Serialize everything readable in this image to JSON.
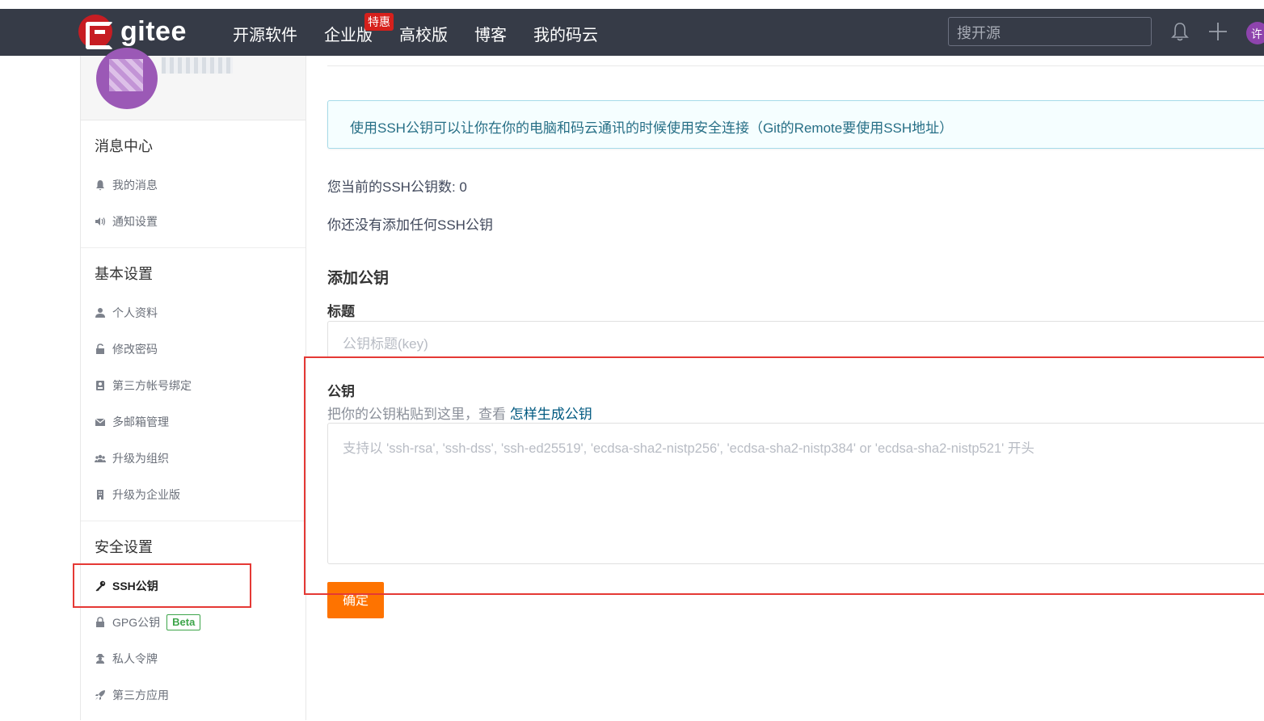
{
  "header": {
    "logo_text": "gitee",
    "nav": [
      {
        "label": "开源软件"
      },
      {
        "label": "企业版",
        "badge": "特惠"
      },
      {
        "label": "高校版"
      },
      {
        "label": "博客"
      },
      {
        "label": "我的码云"
      }
    ],
    "search_placeholder": "搜开源",
    "avatar_initial": "许",
    "icons": [
      "bell-icon",
      "plus-icon"
    ]
  },
  "sidebar": {
    "groups": [
      {
        "title": "消息中心",
        "items": [
          {
            "label": "我的消息",
            "icon": "bell-icon"
          },
          {
            "label": "通知设置",
            "icon": "volume-icon"
          }
        ]
      },
      {
        "title": "基本设置",
        "items": [
          {
            "label": "个人资料",
            "icon": "user-icon"
          },
          {
            "label": "修改密码",
            "icon": "unlock-icon"
          },
          {
            "label": "第三方帐号绑定",
            "icon": "id-card-icon"
          },
          {
            "label": "多邮箱管理",
            "icon": "mail-icon"
          },
          {
            "label": "升级为组织",
            "icon": "users-icon"
          },
          {
            "label": "升级为企业版",
            "icon": "building-icon"
          }
        ]
      },
      {
        "title": "安全设置",
        "items": [
          {
            "label": "SSH公钥",
            "icon": "key-icon",
            "active": true
          },
          {
            "label": "GPG公钥",
            "icon": "lock-icon",
            "badge": "Beta"
          },
          {
            "label": "私人令牌",
            "icon": "user-secret-icon"
          },
          {
            "label": "第三方应用",
            "icon": "rocket-icon"
          }
        ]
      }
    ]
  },
  "main": {
    "info": "使用SSH公钥可以让你在你的电脑和码云通讯的时候使用安全连接（Git的Remote要使用SSH地址）",
    "count_text": "您当前的SSH公钥数: 0",
    "empty_text": "你还没有添加任何SSH公钥",
    "add_heading": "添加公钥",
    "title_label": "标题",
    "title_placeholder": "公钥标题(key)",
    "key_label": "公钥",
    "key_hint": "把你的公钥粘贴到这里，查看 ",
    "key_hint_link": "怎样生成公钥",
    "key_placeholder": "支持以 'ssh-rsa', 'ssh-dss', 'ssh-ed25519', 'ecdsa-sha2-nistp256', 'ecdsa-sha2-nistp384' or 'ecdsa-sha2-nistp521' 开头",
    "submit_label": "确定"
  },
  "colors": {
    "topbar": "#363b47",
    "brand_red": "#c71d23",
    "submit_orange": "#fe7300",
    "highlight_red": "#e53935",
    "beta_green": "#3da54a"
  }
}
